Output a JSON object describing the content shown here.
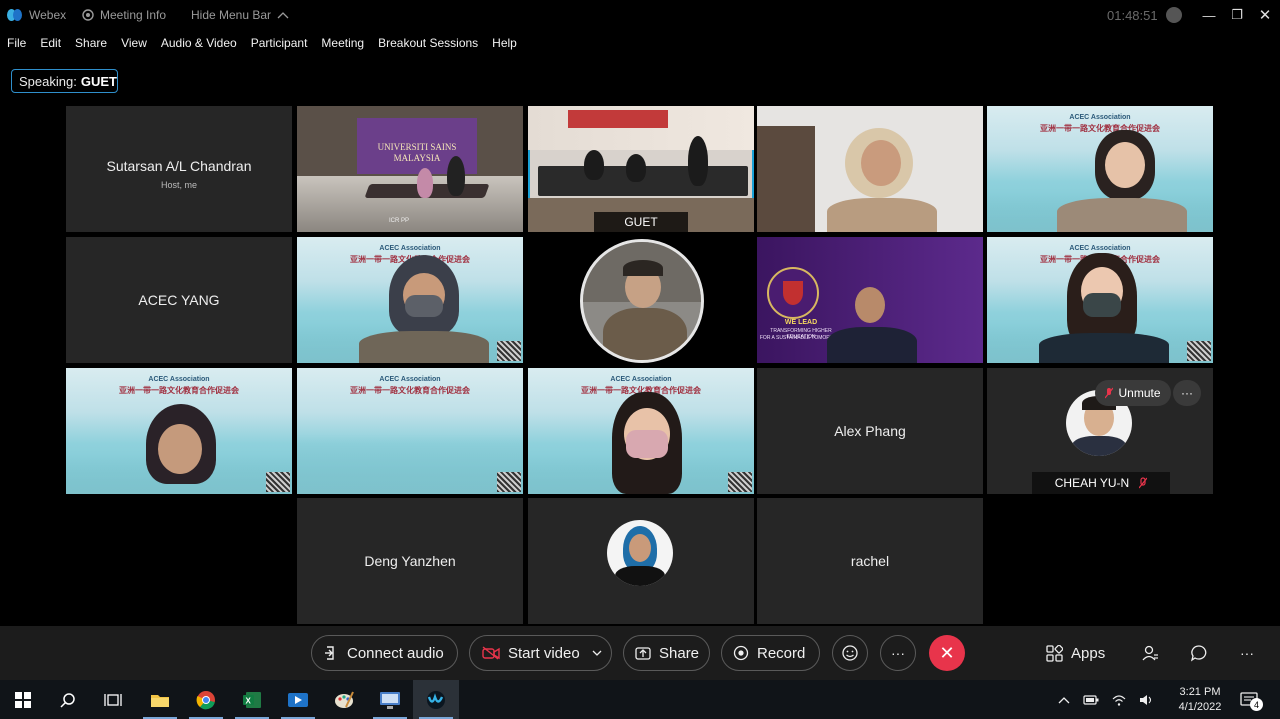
{
  "titlebar": {
    "app_name": "Webex",
    "meeting_info": "Meeting Info",
    "hide_menu": "Hide Menu Bar",
    "timer": "01:48:51"
  },
  "menu": [
    "File",
    "Edit",
    "Share",
    "View",
    "Audio & Video",
    "Participant",
    "Meeting",
    "Breakout Sessions",
    "Help"
  ],
  "speaking": {
    "label": "Speaking:",
    "name": "GUET"
  },
  "tiles": {
    "sutarsan": {
      "name": "Sutarsan A/L Chandran",
      "sub": "Host, me"
    },
    "usm_room": {
      "sign": "UNIVERSITI SAINS MALAYSIA",
      "caption": "ICR PP"
    },
    "guet": {
      "name": "GUET"
    },
    "acec_yang": {
      "name": "ACEC YANG"
    },
    "alex": {
      "name": "Alex Phang"
    },
    "cheah": {
      "name": "CHEAH YU-N",
      "unmute": "Unmute"
    },
    "deng": {
      "name": "Deng Yanzhen"
    },
    "rachel": {
      "name": "rachel"
    },
    "weleads": {
      "line1": "WE LEAD",
      "line2": "TRANSFORMING HIGHER EDUCATION",
      "line3": "FOR A SUSTAINABLE TOMORROW"
    }
  },
  "acec_banner": {
    "title": "ACEC Association",
    "subtitle": "亚洲一带一路文化教育合作促进会"
  },
  "controls": {
    "connect_audio": "Connect audio",
    "start_video": "Start video",
    "share": "Share",
    "record": "Record",
    "apps": "Apps"
  },
  "taskbar": {
    "time": "3:21 PM",
    "date": "4/1/2022",
    "notifications": "4"
  },
  "colors": {
    "accent": "#1aa2d8",
    "end_call": "#e8344b",
    "tile_bg": "#262626"
  }
}
